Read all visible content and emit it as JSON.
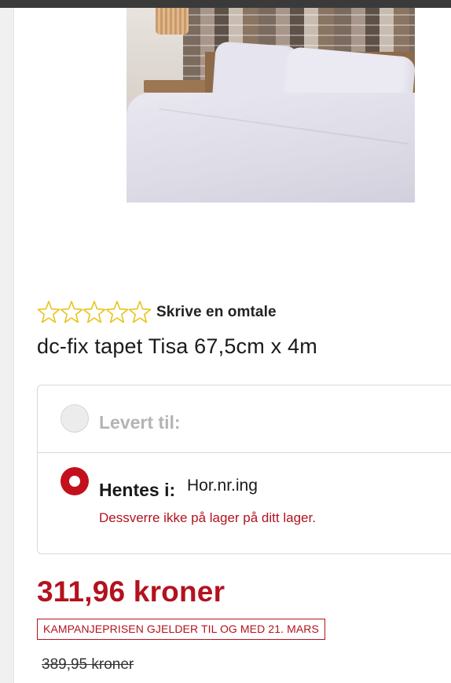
{
  "product": {
    "image_alt": "dc-fix tapet Tisa",
    "rating": {
      "stars_filled": 0,
      "stars_total": 5,
      "review_link": "Skrive en omtale"
    },
    "title": "dc-fix tapet Tisa 67,5cm x 4m"
  },
  "delivery": {
    "delivered_option": {
      "label": "Levert til:",
      "selected": false
    },
    "pickup_option": {
      "label": "Hentes i:",
      "store": "Hor.nr.ing",
      "stock_message": "Dessverre ikke på lager på ditt lager.",
      "selected": true
    }
  },
  "pricing": {
    "price": "311,96 kroner",
    "campaign_note": "KAMPANJEPRISEN GJELDER TIL OG MED 21. MARS",
    "old_price": "389,95 kroner"
  },
  "colors": {
    "accent_red": "#b3121f",
    "star_outline": "#e8c31a",
    "radio_selected": "#c40f1d"
  }
}
